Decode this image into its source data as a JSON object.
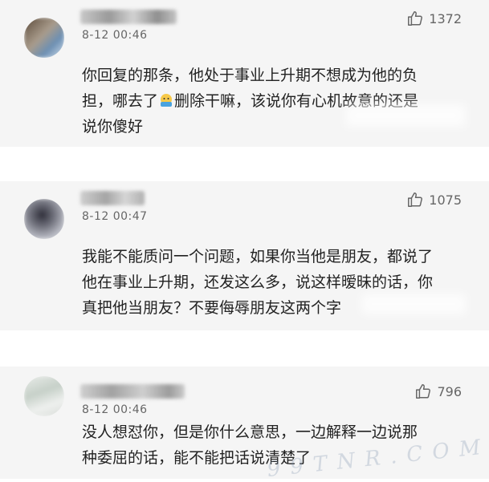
{
  "comments": [
    {
      "timestamp": "8-12 00:46",
      "likes": "1372",
      "lines": [
        "你回复的那条，他处于事业上升期不想成为他的负",
        "担，哪去了",
        "删除干嘛，该说你有心机故意的还是",
        "说你傻好"
      ]
    },
    {
      "timestamp": "8-12 00:47",
      "likes": "1075",
      "lines": [
        "我能不能质问一个问题，如果你当他是朋友，都说了",
        "他在事业上升期，还发这么多，说这样暧昧的话，你",
        "真把他当朋友？不要侮辱朋友这两个字"
      ]
    },
    {
      "timestamp": "8-12 00:46",
      "likes": "796",
      "lines": [
        "没人想怼你，但是你什么意思，一边解释一边说那",
        "种委屈的话，能不能把话说清楚了"
      ]
    }
  ],
  "watermark": "9 9 T N R . C O M",
  "icons": {
    "like": "thumbs-up-icon",
    "emoji": "emoji-icon"
  },
  "colors": {
    "card_background": "#f5f5f5",
    "text": "#222222",
    "meta": "#666666"
  }
}
